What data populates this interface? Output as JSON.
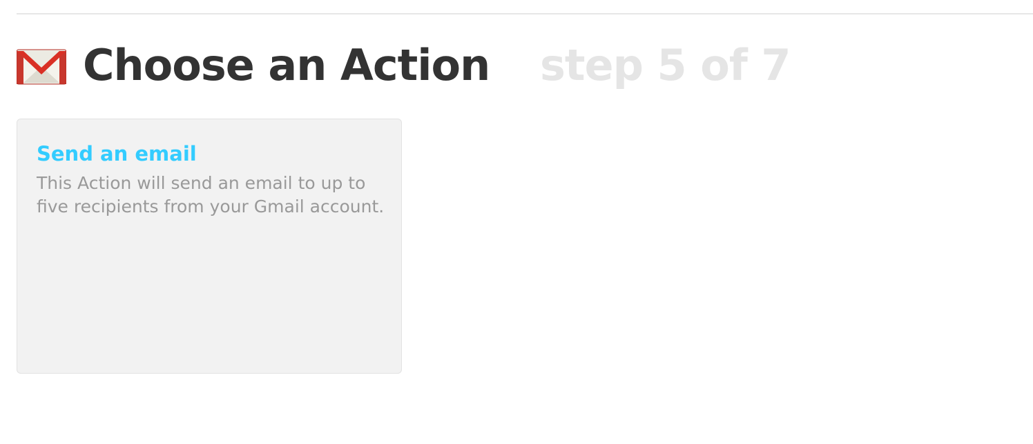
{
  "header": {
    "icon": "gmail-icon",
    "title": "Choose an Action",
    "step": "step 5 of 7"
  },
  "actions": [
    {
      "title": "Send an email",
      "description": "This Action will send an email to up to five recipients from your Gmail account."
    }
  ],
  "colors": {
    "title": "#333333",
    "step": "#e5e5e5",
    "action_title": "#33ccff",
    "action_desc": "#999999",
    "card_bg": "#f2f2f2",
    "gmail_red": "#d93025"
  }
}
